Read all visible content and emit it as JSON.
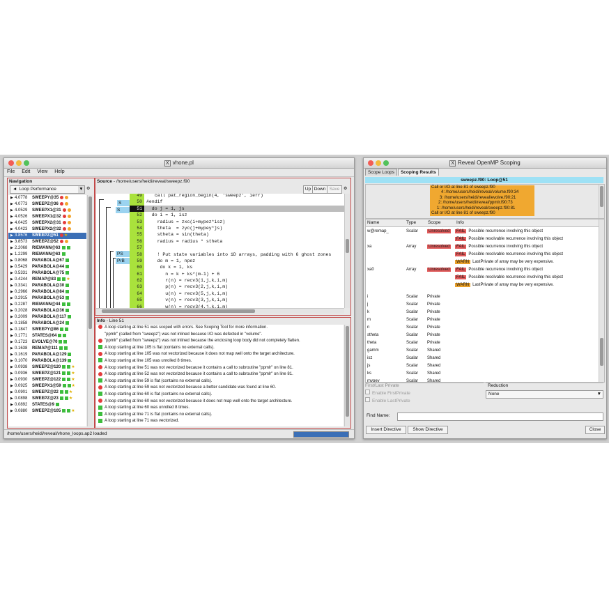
{
  "main_window": {
    "title": "vhone.pl",
    "menus": [
      "File",
      "Edit",
      "View",
      "Help"
    ],
    "navigation": {
      "header": "Navigation",
      "dropdown": "Loop Performance",
      "loops": [
        {
          "val": "4.0778",
          "name": "SWEEPY@35",
          "ic": [
            "dot-red",
            "dot-orange"
          ]
        },
        {
          "val": "4.0773",
          "name": "SWEEPZ@36",
          "ic": [
            "dot-red",
            "dot-orange"
          ]
        },
        {
          "val": "4.0529",
          "name": "SWEEPX1@31",
          "ic": [
            "dot-red",
            "dot-orange"
          ]
        },
        {
          "val": "4.0526",
          "name": "SWEEPX1@32",
          "ic": [
            "dot-red",
            "dot-orange"
          ]
        },
        {
          "val": "4.0425",
          "name": "SWEEPX2@31",
          "ic": [
            "dot-red",
            "dot-orange"
          ]
        },
        {
          "val": "4.0423",
          "name": "SWEEPX2@32",
          "ic": [
            "dot-red",
            "dot-orange"
          ]
        },
        {
          "val": "3.8576",
          "name": "SWEEPZ@51",
          "ic": [
            "dot-red",
            "star"
          ],
          "selected": true
        },
        {
          "val": "3.8573",
          "name": "SWEEPZ@52",
          "ic": [
            "dot-red",
            "dot-orange"
          ]
        },
        {
          "val": "2.2068",
          "name": "RIEMANN@63",
          "ic": [
            "sq-green",
            "sq-green"
          ]
        },
        {
          "val": "1.2299",
          "name": "RIEMANN@63",
          "ic": [
            "sq-green"
          ]
        },
        {
          "val": "0.8068",
          "name": "PARABOLA@67",
          "ic": [
            "sq-green"
          ]
        },
        {
          "val": "0.5429",
          "name": "PARABOLA@44",
          "ic": [
            "sq-green"
          ]
        },
        {
          "val": "0.5331",
          "name": "PARABOLA@75",
          "ic": [
            "sq-green"
          ]
        },
        {
          "val": "0.4244",
          "name": "REMAP@83",
          "ic": [
            "sq-green",
            "sq-green",
            "star"
          ]
        },
        {
          "val": "0.3341",
          "name": "PARABOLA@30",
          "ic": [
            "sq-green"
          ]
        },
        {
          "val": "0.2966",
          "name": "PARABOLA@84",
          "ic": [
            "sq-green"
          ]
        },
        {
          "val": "0.2915",
          "name": "PARABOLA@53",
          "ic": [
            "sq-green"
          ]
        },
        {
          "val": "0.2287",
          "name": "RIEMANN@44",
          "ic": [
            "sq-green",
            "sq-green"
          ]
        },
        {
          "val": "0.2028",
          "name": "PARABOLA@36",
          "ic": [
            "sq-green"
          ]
        },
        {
          "val": "0.2009",
          "name": "PARABOLA@117",
          "ic": [
            "sq-green"
          ]
        },
        {
          "val": "0.1858",
          "name": "PARABOLA@24",
          "ic": [
            "sq-green"
          ]
        },
        {
          "val": "0.1847",
          "name": "SWEEPY@86",
          "ic": [
            "sq-green",
            "sq-green"
          ]
        },
        {
          "val": "0.1771",
          "name": "STATES@64",
          "ic": [
            "sq-green",
            "sq-green"
          ]
        },
        {
          "val": "0.1723",
          "name": "EVOLVE@70",
          "ic": [
            "sq-green",
            "sq-green"
          ]
        },
        {
          "val": "0.1638",
          "name": "REMAP@111",
          "ic": [
            "sq-green",
            "sq-green"
          ]
        },
        {
          "val": "0.1619",
          "name": "PARABOLA@129",
          "ic": [
            "sq-green"
          ]
        },
        {
          "val": "0.1070",
          "name": "PARABOLA@139",
          "ic": [
            "sq-green"
          ]
        },
        {
          "val": "0.0938",
          "name": "SWEEPZ@120",
          "ic": [
            "sq-green",
            "sq-green",
            "star"
          ]
        },
        {
          "val": "0.0936",
          "name": "SWEEPZ@121",
          "ic": [
            "sq-green",
            "sq-green",
            "star"
          ]
        },
        {
          "val": "0.0930",
          "name": "SWEEPZ@122",
          "ic": [
            "sq-green",
            "sq-green",
            "star"
          ]
        },
        {
          "val": "0.0925",
          "name": "SWEEPX1@59",
          "ic": [
            "sq-green",
            "sq-green",
            "star"
          ]
        },
        {
          "val": "0.0901",
          "name": "SWEEPZ@22",
          "ic": [
            "sq-green",
            "sq-green",
            "star"
          ]
        },
        {
          "val": "0.0898",
          "name": "SWEEPZ@23",
          "ic": [
            "sq-green",
            "sq-green",
            "star"
          ]
        },
        {
          "val": "0.0892",
          "name": "STATES@9",
          "ic": [
            "sq-green"
          ]
        },
        {
          "val": "0.0880",
          "name": "SWEEPZ@105",
          "ic": [
            "sq-green",
            "sq-green",
            "star"
          ]
        }
      ]
    },
    "source": {
      "header": "Source",
      "path": "- /home/users/heidi/reveal/sweepz.f90",
      "buttons": [
        "Up",
        "Down",
        "Save"
      ],
      "lines": [
        {
          "n": "49",
          "t": "   call pat_region_begin(4, 'sweepz', ierr)"
        },
        {
          "n": "50",
          "t": "#endif"
        },
        {
          "n": "51",
          "t": "  do j = 1, js",
          "hl": true
        },
        {
          "n": "52",
          "t": "  do i = 1, isz"
        },
        {
          "n": "53",
          "t": "    radius = zxc(i+mypez*isz)"
        },
        {
          "n": "54",
          "t": "    theta  = zyc(j+mypey*js)"
        },
        {
          "n": "55",
          "t": "    stheta = sin(theta)"
        },
        {
          "n": "56",
          "t": "    radius = radius * stheta"
        },
        {
          "n": "57",
          "t": ""
        },
        {
          "n": "58",
          "t": "    ! Put state variables into 1D arrays, padding with 6 ghost zones"
        },
        {
          "n": "59",
          "t": "    do m = 1, npez"
        },
        {
          "n": "60",
          "t": "     do k = 1, ks"
        },
        {
          "n": "61",
          "t": "       n = k + ks*(m-1) + 6"
        },
        {
          "n": "62",
          "t": "       r(n) = recv3(1,j,k,i,m)"
        },
        {
          "n": "63",
          "t": "       p(n) = recv3(2,j,k,i,m)"
        },
        {
          "n": "64",
          "t": "       u(n) = recv3(5,j,k,i,m)"
        },
        {
          "n": "65",
          "t": "       v(n) = recv3(3,j,k,i,m)"
        },
        {
          "n": "66",
          "t": "       w(n) = recv3(4,j,k,i,m)"
        }
      ],
      "gutter_tags": [
        "S",
        "S",
        "PS",
        "PrB"
      ]
    },
    "info": {
      "header": "Info",
      "subheader": "- Line 51",
      "rows": [
        {
          "c": "red",
          "t": "A loop starting at line 51 was scoped with errors.  See Scoping Tool for more information."
        },
        {
          "c": "none",
          "t": "\"ppmlr\" (called from \"sweepz\") was not inlined because I/O was defected in \"volume\"."
        },
        {
          "c": "red",
          "t": "\"ppmlr\" (called from \"sweepz\") was not inlined because the enclosing loop body did not completely flatten."
        },
        {
          "c": "green",
          "t": "A loop starting at line 105 is flat (contains no external calls)."
        },
        {
          "c": "red",
          "t": "A loop starting at line 105 was not vectorized because it does not map well onto the target architecture."
        },
        {
          "c": "green",
          "t": "A loop starting at line 105 was unrolled 8 times."
        },
        {
          "c": "red",
          "t": "A loop starting at line 51 was not vectorized because it contains a call to subroutine \"ppmlr\" on line 81."
        },
        {
          "c": "red",
          "t": "A loop starting at line 52 was not vectorized because it contains a call to subroutine \"ppmlr\" on line 81."
        },
        {
          "c": "green",
          "t": "A loop starting at line 59 is flat (contains no external calls)."
        },
        {
          "c": "red",
          "t": "A loop starting at line 59 was not vectorized because a better candidate was found at line 60."
        },
        {
          "c": "green",
          "t": "A loop starting at line 60 is flat (contains no external calls)."
        },
        {
          "c": "red",
          "t": "A loop starting at line 60 was not vectorized because it does not map well onto the target architecture."
        },
        {
          "c": "green",
          "t": "A loop starting at line 60 was unrolled 8 times."
        },
        {
          "c": "green",
          "t": "A loop starting at line 71 is flat (contains no external calls)."
        },
        {
          "c": "green",
          "t": "A loop starting at line 71 was vectorized."
        }
      ]
    },
    "status": "/home/users/heidi/reveal/vhone_loops.ap2 loaded"
  },
  "scoping_window": {
    "title": "Reveal OpenMP Scoping",
    "tabs": [
      "Scope Loops",
      "Scoping Results"
    ],
    "loop_header": "sweepz.f90: Loop@51",
    "call_tree": [
      "Call or I/O at line 81 of sweepz.f90",
      "4: /home/users/heidi/reveal/volume.f90:34",
      "3: /home/users/heidi/reveal/evolve.f90:21",
      "2: /home/users/heidi/reveal/ppmlr.f90:73",
      "1: /home/users/heidi/reveal/sweepz.f90:81",
      "Call or I/O at line 81 of sweepz.f90"
    ],
    "columns": [
      "Name",
      "Type",
      "Scope",
      "Info"
    ],
    "rows": [
      {
        "name": "w@remap_",
        "type": "Scalar",
        "scope": "Unresolved",
        "info": [
          {
            "tag": "FAIL",
            "t": "Possible recurrence involving this object"
          },
          {
            "tag": "FAIL",
            "t": "Possible resolvable recurrence involving this object"
          }
        ]
      },
      {
        "name": "xa",
        "type": "Array",
        "scope": "Unresolved",
        "info": [
          {
            "tag": "FAIL",
            "t": "Possible recurrence involving this object"
          },
          {
            "tag": "FAIL",
            "t": "Possible resolvable recurrence involving this object"
          },
          {
            "tag": "WARN",
            "t": "LastPrivate of array may be very expensive."
          }
        ]
      },
      {
        "name": "xa0",
        "type": "Array",
        "scope": "Unresolved",
        "info": [
          {
            "tag": "FAIL",
            "t": "Possible recurrence involving this object"
          },
          {
            "tag": "FAIL",
            "t": "Possible resolvable recurrence involving this object"
          },
          {
            "tag": "WARN",
            "t": "LastPrivate of array may be very expensive."
          }
        ]
      },
      {
        "name": "i",
        "type": "Scalar",
        "scope": "Private",
        "info": []
      },
      {
        "name": "j",
        "type": "Scalar",
        "scope": "Private",
        "info": []
      },
      {
        "name": "k",
        "type": "Scalar",
        "scope": "Private",
        "info": []
      },
      {
        "name": "m",
        "type": "Scalar",
        "scope": "Private",
        "info": []
      },
      {
        "name": "n",
        "type": "Scalar",
        "scope": "Private",
        "info": []
      },
      {
        "name": "stheta",
        "type": "Scalar",
        "scope": "Private",
        "info": []
      },
      {
        "name": "theta",
        "type": "Scalar",
        "scope": "Private",
        "info": []
      },
      {
        "name": "gamm",
        "type": "Scalar",
        "scope": "Shared",
        "info": []
      },
      {
        "name": "isz",
        "type": "Scalar",
        "scope": "Shared",
        "info": []
      },
      {
        "name": "js",
        "type": "Scalar",
        "scope": "Shared",
        "info": []
      },
      {
        "name": "ks",
        "type": "Scalar",
        "scope": "Shared",
        "info": []
      },
      {
        "name": "mypey",
        "type": "Scalar",
        "scope": "Shared",
        "info": []
      }
    ],
    "first_last_private_label": "First/Last Private",
    "enable_first_private": "Enable FirstPrivate",
    "enable_last_private": "Enable LastPrivate",
    "reduction_label": "Reduction",
    "reduction_value": "None",
    "find_name_label": "Find Name:",
    "insert_directive": "Insert Directive",
    "show_directive": "Show Directive",
    "close": "Close"
  }
}
